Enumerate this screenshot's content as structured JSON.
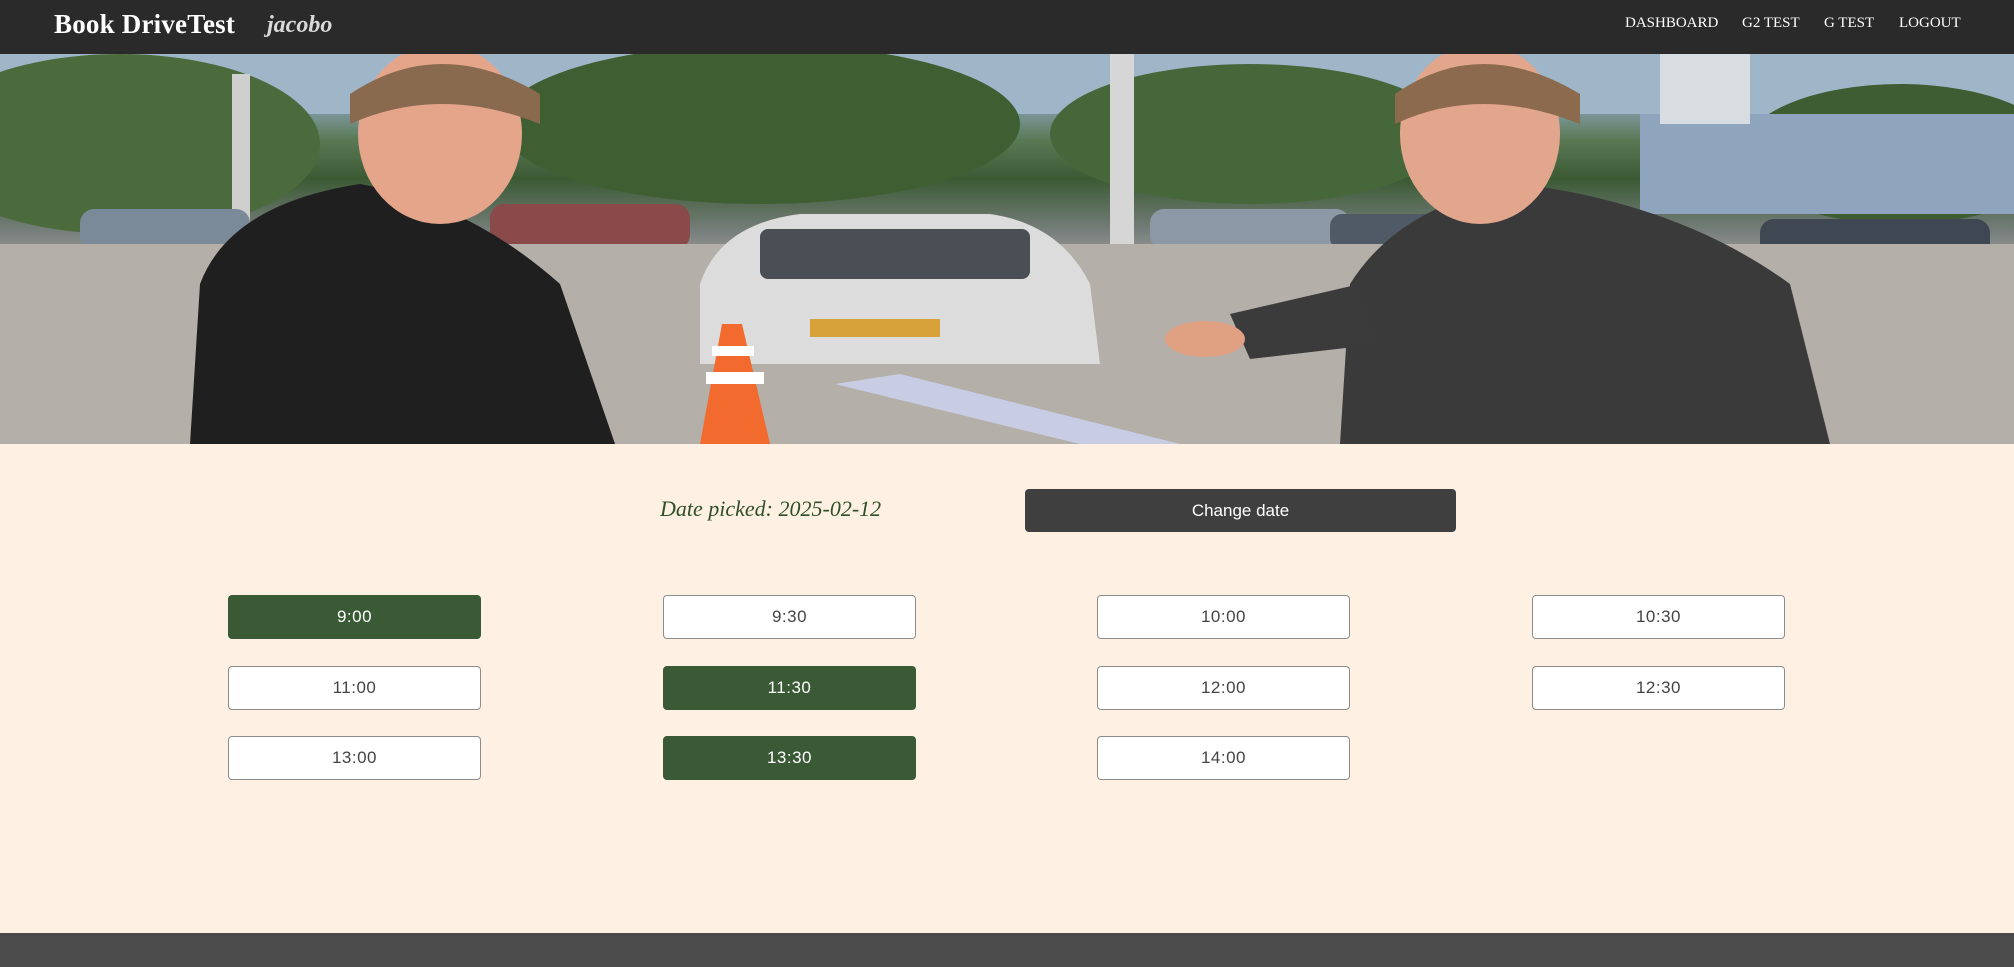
{
  "navbar": {
    "brand": "Book DriveTest",
    "username": "jacobo",
    "links": {
      "dashboard": "DASHBOARD",
      "g2_test": "G2 TEST",
      "g_test": "G TEST",
      "logout": "LOGOUT"
    }
  },
  "booking": {
    "date_picked": "Date picked: 2025-02-12",
    "change_date_label": "Change date",
    "slots": [
      {
        "time": "9:00",
        "status": "unavailable"
      },
      {
        "time": "9:30",
        "status": "available"
      },
      {
        "time": "10:00",
        "status": "available"
      },
      {
        "time": "10:30",
        "status": "available"
      },
      {
        "time": "11:00",
        "status": "available"
      },
      {
        "time": "11:30",
        "status": "unavailable"
      },
      {
        "time": "12:00",
        "status": "available"
      },
      {
        "time": "12:30",
        "status": "available"
      },
      {
        "time": "13:00",
        "status": "available"
      },
      {
        "time": "13:30",
        "status": "unavailable"
      },
      {
        "time": "14:00",
        "status": "available"
      }
    ]
  },
  "colors": {
    "navbar_bg": "#2a2a2a",
    "page_bg": "#fef1e3",
    "unavailable_slot": "#3a5a36",
    "change_date_bg": "#3f3f3f",
    "footer_bg": "#4b4b4b"
  }
}
